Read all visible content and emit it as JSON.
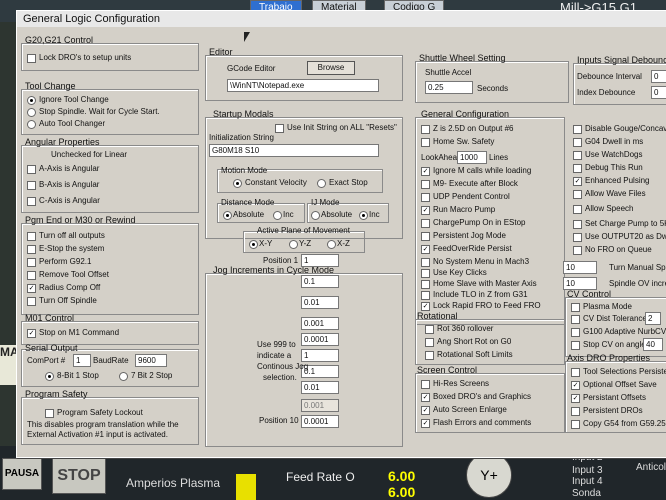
{
  "background": {
    "tabs": [
      "Trabajo",
      "Material",
      "Codigo G"
    ],
    "mill_label": "Mill->G15  G1",
    "pausa": "PAUSA",
    "stop": "STOP",
    "amperios": "Amperios Plasma",
    "feed_rate_label": "Feed Rate O",
    "feed_rate_value": "6.00",
    "feed_rate_value2": "6.00",
    "y_plus": "Y+",
    "input2": "Input 2",
    "input3": "Input 3",
    "input4": "Input 4",
    "sonda": "Sonda",
    "anticol": "Anticol",
    "side_letters": "MA"
  },
  "dialog": {
    "title": "General Logic Configuration",
    "g20": {
      "label": "G20,G21 Control",
      "lock_dros": "Lock DRO's to setup units"
    },
    "tool_change": {
      "label": "Tool Change",
      "ignore": "Ignore Tool Change",
      "stop_spindle": "Stop Spindle. Wait for Cycle Start.",
      "auto": "Auto Tool Changer"
    },
    "angular": {
      "label": "Angular Properties",
      "unchecked": "Unchecked for Linear",
      "a_axis": "A-Axis is Angular",
      "b_axis": "B-Axis is Angular",
      "c_axis": "C-Axis is Angular"
    },
    "pgm_end": {
      "label": "Pgm End or M30 or Rewind",
      "items": [
        "Turn off all outputs",
        "E-Stop the system",
        "Perform G92.1",
        "Remove Tool Offset",
        "Radius Comp Off",
        "Turn Off Spindle"
      ]
    },
    "m01": {
      "label": "M01 Control",
      "stop": "Stop on M1 Command"
    },
    "serial": {
      "label": "Serial Output",
      "comport_label": "ComPort #",
      "comport": "1",
      "baud_label": "BaudRate",
      "baud": "9600",
      "bit8": "8-Bit 1 Stop",
      "bit7": "7 Bit 2 Stop"
    },
    "safety": {
      "label": "Program Safety",
      "lockout": "Program Safety Lockout",
      "desc1": "This disables program translation while the",
      "desc2": "External Activation #1 input is activated."
    },
    "editor": {
      "label": "Editor",
      "gcode": "GCode Editor",
      "browse": "Browse",
      "path": "\\WinNT\\Notepad.exe"
    },
    "startup": {
      "label": "Startup Modals",
      "use_init": "Use Init String on ALL \"Resets\"",
      "init_label": "Initialization String",
      "init_value": "G80M18 S10",
      "motion_label": "Motion Mode",
      "constant": "Constant Velocity",
      "exact": "Exact Stop",
      "distance_label": "Distance Mode",
      "absolute": "Absolute",
      "inc": "Inc",
      "ij_label": "IJ Mode",
      "ij_absolute": "Absolute",
      "ij_inc": "Inc",
      "plane_label": "Active Plane of Movement",
      "xy": "X-Y",
      "yz": "Y-Z",
      "xz": "X-Z"
    },
    "jog": {
      "label": "Jog Increments in Cycle Mode",
      "pos1": "Position 1",
      "note1": "Use 999 to",
      "note2": "indicate a",
      "note3": "Continous Jog",
      "note4": "selection.",
      "pos10": "Position 10",
      "values": [
        "1",
        "0.1",
        "0.01",
        "0.001",
        "0.0001",
        "1",
        "0.1",
        "0.01",
        "0.001",
        "0.0001"
      ]
    },
    "shuttle": {
      "label": "Shuttle Wheel Setting",
      "accel_label": "Shuttle Accel",
      "accel_value": "0.25",
      "seconds": "Seconds"
    },
    "general": {
      "label": "General Configuration",
      "z25d": "Z is 2.5D on Output #6",
      "home_safety": "Home Sw. Safety",
      "lookahead_label": "LookAhead",
      "lookahead_value": "1000",
      "lines": "Lines",
      "ignore_m": "Ignore M calls while loading",
      "m9": "M9- Execute after Block",
      "udp": "UDP Pendent Control",
      "run_macro": "Run Macro Pump",
      "chargepump": "ChargePump On in EStop",
      "persistent_jog": "Persistent Jog Mode",
      "feed_persist": "FeedOverRide Persist",
      "no_system": "No System Menu in Mach3",
      "key_clicks": "Use Key Clicks",
      "home_slave": "Home Slave with Master Axis",
      "include_tlo": "Include TLO in Z from G31",
      "lock_rapid": "Lock Rapid FRO to Feed FRO",
      "rotational_label": "Rotational",
      "rot360": "Rot 360 rollover",
      "ang_short": "Ang Short Rot on G0",
      "rot_soft": "Rotational Soft Limits"
    },
    "screen": {
      "label": "Screen Control",
      "hires": "Hi-Res Screens",
      "boxed": "Boxed DRO's and Graphics",
      "auto_enlarge": "Auto Screen Enlarge",
      "flash": "Flash Errors and comments"
    },
    "inputs": {
      "label": "Inputs Signal Debounce",
      "debounce_label": "Debounce Interval",
      "debounce_value": "0",
      "index_label": "Index Debounce",
      "index_value": "0"
    },
    "right_checks": {
      "disable_gouge": "Disable Gouge/Concavity",
      "g04": "G04 Dwell in ms",
      "watchdogs": "Use WatchDogs",
      "debug": "Debug This Run",
      "enhanced": "Enhanced Pulsing",
      "allow_wave": "Allow Wave Files",
      "allow_speech": "Allow Speech",
      "set_charge": "Set Charge Pump to 5Khz",
      "output20": "Use OUTPUT20 as Dwell",
      "no_fro": "No FRO on Queue",
      "turn_manual_label": "Turn Manual Spin",
      "turn_manual_value": "10",
      "spindle_ov_label": "Spindle OV increm",
      "spindle_ov_value": "10"
    },
    "cv": {
      "label": "CV Control",
      "plasma": "Plasma Mode",
      "dist_tol": "CV Dist Tolerance",
      "dist_value": "2",
      "g100": "G100 Adaptive NurbCV",
      "stop_cv": "Stop CV on angles >",
      "angle_value": "40"
    },
    "axis_dro": {
      "label": "Axis DRO Properties",
      "tool_sel": "Tool Selections Persistent",
      "optional_offset": "Optional Offset Save",
      "persist_offsets": "Persistant Offsets",
      "persist_dros": "Persistent DROs",
      "copy_g54": "Copy G54 from G59.253 on start"
    }
  }
}
